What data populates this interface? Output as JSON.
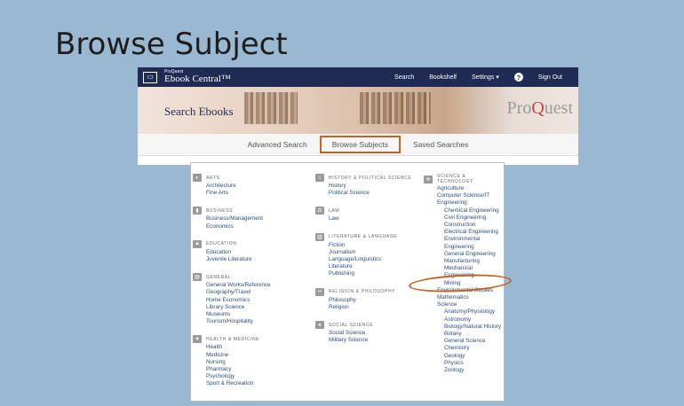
{
  "slide": {
    "title": "Browse Subject"
  },
  "topbar": {
    "brand_small": "ProQuest",
    "brand_big": "Ebook Central™",
    "nav": [
      "Search",
      "Bookshelf",
      "Settings ▾",
      "Sign Out"
    ]
  },
  "banner": {
    "title": "Search Ebooks",
    "logo_pre": "Pro",
    "logo_q": "Q",
    "logo_post": "uest"
  },
  "tabs": [
    "Advanced Search",
    "Browse Subjects",
    "Saved Searches"
  ],
  "columns": [
    {
      "categories": [
        {
          "title": "ARTS",
          "icon": "palette-icon",
          "items": [
            "Architecture",
            "Fine Arts"
          ]
        },
        {
          "title": "BUSINESS",
          "icon": "chart-icon",
          "items": [
            "Business/Management",
            "Economics"
          ]
        },
        {
          "title": "EDUCATION",
          "icon": "graduation-cap-icon",
          "items": [
            "Education",
            "Juvenile Literature"
          ]
        },
        {
          "title": "GENERAL",
          "icon": "book-icon",
          "items": [
            "General Works/Reference",
            "Geography/Travel",
            "Home Economics",
            "Library Science",
            "Museums",
            "Tourism/Hospitality"
          ]
        },
        {
          "title": "HEALTH & MEDICINE",
          "icon": "heart-icon",
          "items": [
            "Health",
            "Medicine",
            "Nursing",
            "Pharmacy",
            "Psychology",
            "Sport & Recreation"
          ]
        }
      ]
    },
    {
      "categories": [
        {
          "title": "HISTORY & POLITICAL SCIENCE",
          "icon": "landmark-icon",
          "items": [
            "History",
            "Political Science"
          ]
        },
        {
          "title": "LAW",
          "icon": "scales-icon",
          "items": [
            "Law"
          ]
        },
        {
          "title": "LITERATURE & LANGUAGE",
          "icon": "books-icon",
          "items": [
            "Fiction",
            "Journalism",
            "Language/Linguistics",
            "Literature",
            "Publishing"
          ]
        },
        {
          "title": "RELIGION & PHILOSOPHY",
          "icon": "infinity-icon",
          "items": [
            "Philosophy",
            "Religion"
          ]
        },
        {
          "title": "SOCIAL SCIENCE",
          "icon": "people-icon",
          "items": [
            "Social Science",
            "Military Science"
          ]
        }
      ]
    },
    {
      "categories": [
        {
          "title": "SCIENCE & TECHNOLOGY",
          "icon": "atom-icon",
          "items": [
            {
              "t": "Agriculture",
              "s": 0
            },
            {
              "t": "Computer Science/IT",
              "s": 0
            },
            {
              "t": "Engineering",
              "s": 0
            },
            {
              "t": "Chemical Engineering",
              "s": 1
            },
            {
              "t": "Civil Engineering",
              "s": 1
            },
            {
              "t": "Construction",
              "s": 1
            },
            {
              "t": "Electrical Engineering",
              "s": 1
            },
            {
              "t": "Environmental Engineering",
              "s": 1
            },
            {
              "t": "General Engineering",
              "s": 1
            },
            {
              "t": "Manufacturing",
              "s": 1
            },
            {
              "t": "Mechanical Engineering",
              "s": 1
            },
            {
              "t": "Mining",
              "s": 1
            },
            {
              "t": "Environmental Studies",
              "s": 0
            },
            {
              "t": "Mathematics",
              "s": 0
            },
            {
              "t": "Science",
              "s": 0
            },
            {
              "t": "Anatomy/Physiology",
              "s": 1
            },
            {
              "t": "Astronomy",
              "s": 1
            },
            {
              "t": "Biology/Natural History",
              "s": 1
            },
            {
              "t": "Botany",
              "s": 1
            },
            {
              "t": "General Science",
              "s": 1
            },
            {
              "t": "Chemistry",
              "s": 1
            },
            {
              "t": "Geology",
              "s": 1
            },
            {
              "t": "Physics",
              "s": 1
            },
            {
              "t": "Zoology",
              "s": 1
            }
          ]
        }
      ]
    }
  ],
  "highlight": "Environmental Studies"
}
